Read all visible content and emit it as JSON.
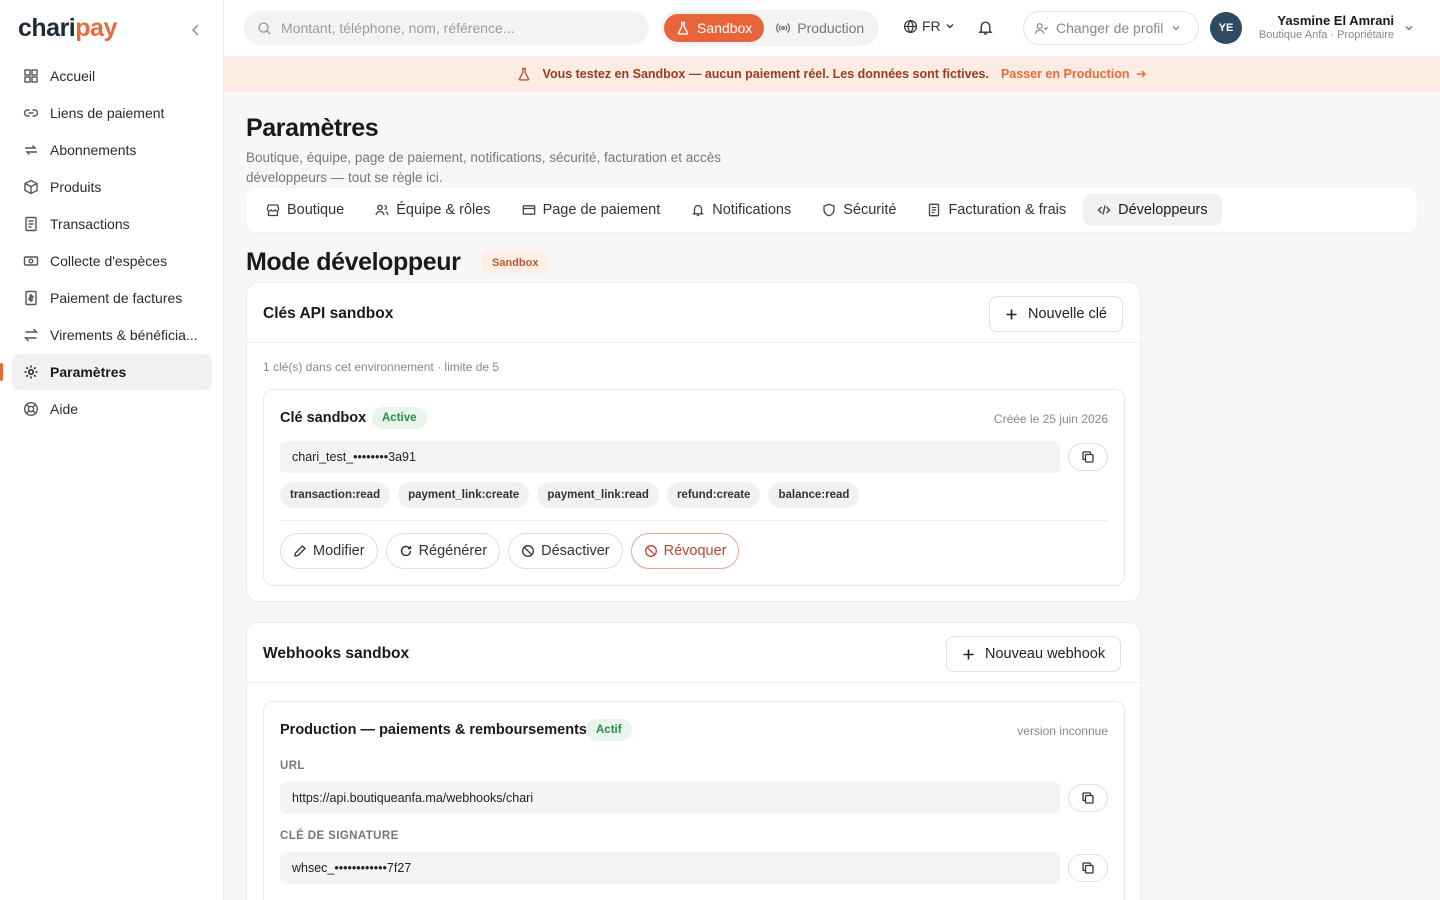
{
  "brand": {
    "logo_main": "chari",
    "logo_accent": "pay",
    "accent_color": "#e86a3a"
  },
  "sidebar": {
    "items": [
      {
        "label": "Accueil",
        "icon": "grid-icon"
      },
      {
        "label": "Liens de paiement",
        "icon": "link-icon"
      },
      {
        "label": "Abonnements",
        "icon": "repeat-icon"
      },
      {
        "label": "Produits",
        "icon": "box-icon"
      },
      {
        "label": "Transactions",
        "icon": "receipt-icon"
      },
      {
        "label": "Collecte d'espèces",
        "icon": "cash-icon"
      },
      {
        "label": "Paiement de factures",
        "icon": "invoice-icon"
      },
      {
        "label": "Virements & bénéficia...",
        "icon": "transfer-icon"
      },
      {
        "label": "Paramètres",
        "icon": "gear-icon",
        "active": true
      },
      {
        "label": "Aide",
        "icon": "help-icon"
      }
    ]
  },
  "topbar": {
    "search_placeholder": "Montant, téléphone, nom, référence...",
    "env": {
      "sandbox": "Sandbox",
      "production": "Production",
      "selected": "Sandbox"
    },
    "lang": "FR",
    "profile_switch": "Changer de profil",
    "user": {
      "initials": "YE",
      "name": "Yasmine El Amrani",
      "role": "Boutique Anfa · Propriétaire"
    }
  },
  "banner": {
    "text": "Vous testez en Sandbox — aucun paiement réel. Les données sont fictives.",
    "link": "Passer en Production"
  },
  "page": {
    "title": "Paramètres",
    "subtitle": "Boutique, équipe, page de paiement, notifications, sécurité, facturation et accès développeurs — tout se règle ici."
  },
  "tabs": [
    {
      "label": "Boutique",
      "icon": "store-icon"
    },
    {
      "label": "Équipe & rôles",
      "icon": "users-icon"
    },
    {
      "label": "Page de paiement",
      "icon": "card-icon"
    },
    {
      "label": "Notifications",
      "icon": "bell-icon"
    },
    {
      "label": "Sécurité",
      "icon": "shield-icon"
    },
    {
      "label": "Facturation & frais",
      "icon": "document-icon"
    },
    {
      "label": "Développeurs",
      "icon": "code-icon",
      "active": true
    }
  ],
  "dev": {
    "title": "Mode développeur",
    "badge": "Sandbox",
    "api_keys": {
      "title": "Clés API sandbox",
      "new_button": "Nouvelle clé",
      "count_text": "1 clé(s) dans cet environnement · limite de 5",
      "key": {
        "name": "Clé sandbox",
        "status": "Active",
        "created": "Créée le 25 juin 2026",
        "value": "chari_test_••••••••3a91",
        "scopes": [
          "transaction:read",
          "payment_link:create",
          "payment_link:read",
          "refund:create",
          "balance:read"
        ],
        "actions": {
          "edit": "Modifier",
          "regenerate": "Régénérer",
          "disable": "Désactiver",
          "revoke": "Révoquer"
        }
      }
    },
    "webhooks": {
      "title": "Webhooks sandbox",
      "new_button": "Nouveau webhook",
      "item": {
        "name": "Production — paiements & remboursements",
        "status": "Actif",
        "version": "version inconnue",
        "url_label": "URL",
        "url": "https://api.boutiqueanfa.ma/webhooks/chari",
        "secret_label": "CLÉ DE SIGNATURE",
        "secret": "whsec_••••••••••••7f27"
      }
    }
  }
}
